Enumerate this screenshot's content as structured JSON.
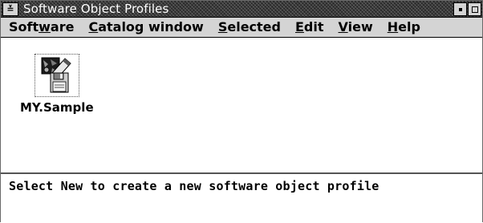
{
  "window": {
    "title": "Software Object Profiles",
    "sysmenu_glyph": "≚",
    "sysmenu_icon": "system-menu-icon",
    "minimize_icon": "minimize-icon",
    "maximize_icon": "maximize-icon"
  },
  "menubar": {
    "items": [
      {
        "pre": "Soft",
        "mnemonic": "w",
        "post": "are"
      },
      {
        "pre": "",
        "mnemonic": "C",
        "post": "atalog window"
      },
      {
        "pre": "",
        "mnemonic": "S",
        "post": "elected"
      },
      {
        "pre": "",
        "mnemonic": "E",
        "post": "dit"
      },
      {
        "pre": "",
        "mnemonic": "V",
        "post": "iew"
      },
      {
        "pre": "",
        "mnemonic": "H",
        "post": "elp"
      }
    ]
  },
  "objects": [
    {
      "label": "MY.Sample",
      "icon": "software-object-icon"
    }
  ],
  "status": {
    "message": "Select New to create a new software object profile"
  }
}
